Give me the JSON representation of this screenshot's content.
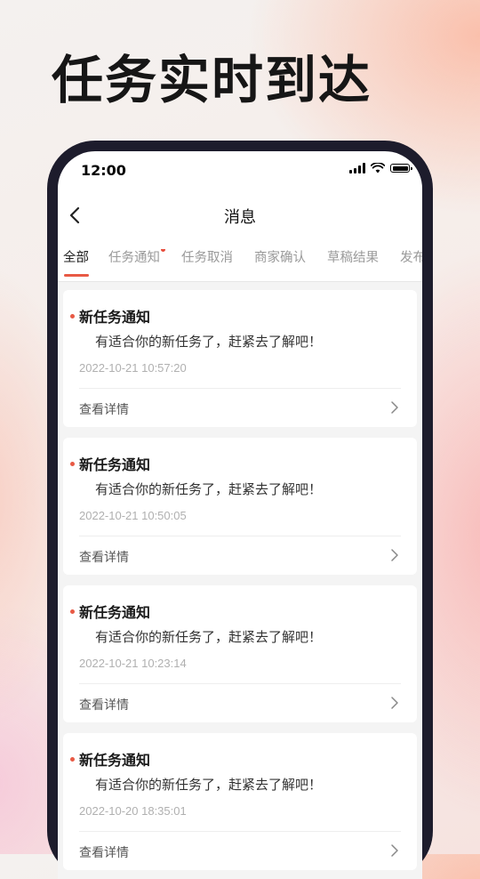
{
  "hero": {
    "title": "任务实时到达"
  },
  "status_bar": {
    "time": "12:00",
    "icons": [
      "signal-icon",
      "wifi-icon",
      "battery-icon"
    ]
  },
  "nav": {
    "title": "消息",
    "back_icon": "chevron-left-icon"
  },
  "tabs": [
    {
      "label": "全部",
      "active": true
    },
    {
      "label": "任务通知",
      "has_dot": true
    },
    {
      "label": "任务取消"
    },
    {
      "label": "商家确认"
    },
    {
      "label": "草稿结果"
    },
    {
      "label": "发布"
    }
  ],
  "messages": [
    {
      "title": "新任务通知",
      "body": "有适合你的新任务了，赶紧去了解吧！",
      "time": "2022-10-21 10:57:20",
      "action": "查看详情"
    },
    {
      "title": "新任务通知",
      "body": "有适合你的新任务了，赶紧去了解吧！",
      "time": "2022-10-21 10:50:05",
      "action": "查看详情"
    },
    {
      "title": "新任务通知",
      "body": "有适合你的新任务了，赶紧去了解吧！",
      "time": "2022-10-21 10:23:14",
      "action": "查看详情"
    },
    {
      "title": "新任务通知",
      "body": "有适合你的新任务了，赶紧去了解吧！",
      "time": "2022-10-20 18:35:01",
      "action": "查看详情"
    }
  ],
  "colors": {
    "accent": "#e85a45",
    "frame": "#1d1c2c"
  }
}
